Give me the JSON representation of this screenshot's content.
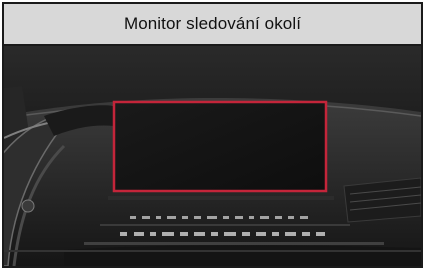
{
  "header": {
    "title": "Monitor sledování okolí"
  },
  "illustration": {
    "subject": "dashboard-interior",
    "highlight_color": "#c4253a",
    "highlighted_item": "center-display"
  }
}
